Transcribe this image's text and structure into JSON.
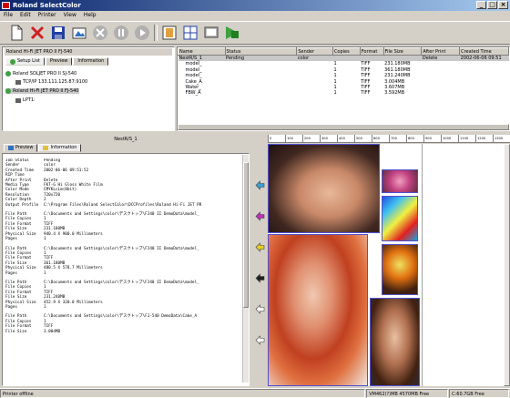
{
  "window": {
    "title": "Roland SelectColor"
  },
  "menu": [
    "File",
    "Edit",
    "Printer",
    "View",
    "Help"
  ],
  "toolbar": [
    "new-doc-icon",
    "delete-icon",
    "save-icon",
    "layout-icon",
    "cancel-icon",
    "pause-icon",
    "play-icon",
    "queue-icon",
    "grid-icon",
    "preview-icon",
    "monitor-icon"
  ],
  "printers": {
    "title": "Roland Hi-Fi JET PRO II FJ-540",
    "tabs": [
      "Setup List",
      "Preview",
      "Information"
    ],
    "items": [
      {
        "label": "Roland SOLJET PRO II SJ-540",
        "color": "#40a040"
      },
      {
        "label": "TCP/IP 133.111.125.87:9100",
        "color": ""
      },
      {
        "label": "Roland Hi-Fi JET PRO II FJ-540",
        "color": "#40a040"
      },
      {
        "label": "LPT1:",
        "color": ""
      }
    ]
  },
  "jobs": {
    "columns": [
      "Name",
      "Status",
      "Sender",
      "Copies",
      "Format",
      "File Size",
      "After Print",
      "Created Time"
    ],
    "rows": [
      [
        "NestR/S_1",
        "Pending",
        "color",
        "",
        "",
        "",
        "Delete",
        "2002-06-06 09:51"
      ],
      [
        "model_",
        "",
        "",
        "1",
        "TIFF",
        "231.180MB",
        "",
        ""
      ],
      [
        "model_",
        "",
        "",
        "1",
        "TIFF",
        "361.180MB",
        "",
        ""
      ],
      [
        "model_",
        "",
        "",
        "1",
        "TIFF",
        "231.240MB",
        "",
        ""
      ],
      [
        "Cake_A",
        "",
        "",
        "1",
        "TIFF",
        "3.004MB",
        "",
        ""
      ],
      [
        "Water_",
        "",
        "",
        "1",
        "TIFF",
        "3.607MB",
        "",
        ""
      ],
      [
        "FBW_A",
        "",
        "",
        "1",
        "TIFF",
        "3.592MB",
        "",
        ""
      ]
    ]
  },
  "details": {
    "title": "NestR/S_1",
    "tabs": [
      "Preview",
      "Information"
    ],
    "header": [
      [
        "Job Status",
        "Pending"
      ],
      [
        "Sender",
        "color"
      ],
      [
        "Created Time",
        "2002-06-06 09:51:52"
      ],
      [
        "RIP Time",
        ""
      ],
      [
        "After Print",
        "Delete"
      ],
      [
        "Media Type",
        "FKT-G  Hi Gloss White Film"
      ],
      [
        "Color Mode",
        "CMYKLcLm(8bit)"
      ],
      [
        "Resolution",
        "720x720"
      ],
      [
        "Color Depth",
        "2"
      ],
      [
        "Output Profile",
        "C:\\Program Files\\Roland SelectColor\\DCCProfiles\\Roland Hi-Fi JET PR"
      ]
    ],
    "files": [
      [
        [
          "File Path",
          "C:\\Documents and Settings\\color\\デスクトップ\\FJ40 II DemoData\\model_"
        ],
        [
          "File Copies",
          "1"
        ],
        [
          "File Format",
          "TIFF"
        ],
        [
          "File Size",
          "231.180MB"
        ],
        [
          "Physical Size",
          "940.4 X 900.0 Millimeters"
        ],
        [
          "Pages",
          "1"
        ]
      ],
      [
        [
          "File Path",
          "C:\\Documents and Settings\\color\\デスクトップ\\FJ40 II DemoData\\model_"
        ],
        [
          "File Copies",
          "1"
        ],
        [
          "File Format",
          "TIFF"
        ],
        [
          "File Size",
          "361.180MB"
        ],
        [
          "Physical Size",
          "480.5 X 578.7 Millimeters"
        ],
        [
          "Pages",
          "1"
        ]
      ],
      [
        [
          "File Path",
          "C:\\Documents and Settings\\color\\デスクトップ\\FJ40 II DemoData\\model_"
        ],
        [
          "File Copies",
          "1"
        ],
        [
          "File Format",
          "TIFF"
        ],
        [
          "File Size",
          "231.240MB"
        ],
        [
          "Physical Size",
          "452.9 X 320.0 Millimeters"
        ],
        [
          "Pages",
          "1"
        ]
      ],
      [
        [
          "File Path",
          "C:\\Documents and Settings\\color\\デスクトップ\\FJ-540 DemoData\\Cake_A"
        ],
        [
          "File Copies",
          "1"
        ],
        [
          "File Format",
          "TIFF"
        ],
        [
          "File Size",
          "3.004MB"
        ]
      ]
    ]
  },
  "ruler": [
    "0",
    "100",
    "200",
    "300",
    "400",
    "500",
    "600",
    "700",
    "800",
    "900",
    "1000",
    "1100",
    "1200",
    "1300"
  ],
  "layout_arrows": [
    {
      "color": "#3aa0d8"
    },
    {
      "color": "#c030c0"
    },
    {
      "color": "#e8d020"
    },
    {
      "color": "#202020"
    },
    {
      "color": "#ffffff"
    },
    {
      "color": "#ffffff"
    }
  ],
  "status": {
    "left": "Printer offline",
    "mid": "VM462(?)MB 4570MB Free",
    "right": "C:60.7GB Free"
  }
}
